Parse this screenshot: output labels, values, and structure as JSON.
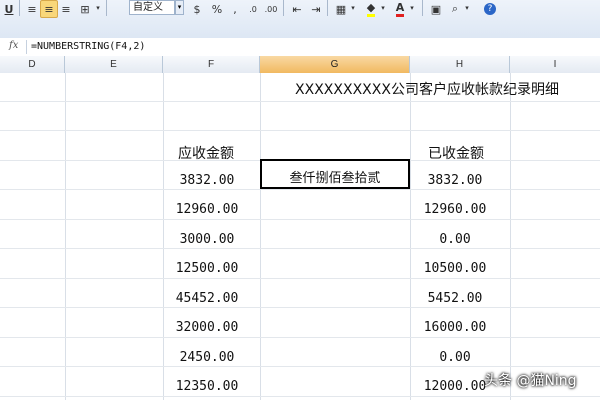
{
  "toolbar": {
    "number_format": "自定义",
    "icons": [
      "underline-icon",
      "align-left-icon",
      "align-center-icon",
      "align-right-icon",
      "merge-center-icon",
      "currency-icon",
      "percent-icon",
      "comma-icon",
      "increase-decimal-icon",
      "decrease-decimal-icon",
      "indent-decrease-icon",
      "indent-increase-icon",
      "borders-icon",
      "fill-color-icon",
      "font-color-icon",
      "picture-icon",
      "zoom-icon",
      "help-icon"
    ],
    "font_color_glyph": "A",
    "percent_glyph": "%"
  },
  "formula_bar": {
    "fx_label": "fx",
    "formula": "=NUMBERSTRING(F4,2)"
  },
  "columns": [
    "D",
    "E",
    "F",
    "G",
    "H",
    "I"
  ],
  "sheet": {
    "title": "XXXXXXXXXX公司客户应收帐款纪录明细",
    "header_receivable": "应收金额",
    "header_received": "已收金额",
    "active_cell_text": "叁仟捌佰叁拾贰",
    "receivable": [
      "3832.00",
      "12960.00",
      "3000.00",
      "12500.00",
      "45452.00",
      "32000.00",
      "2450.00",
      "12350.00"
    ],
    "received": [
      "3832.00",
      "12960.00",
      "0.00",
      "10500.00",
      "5452.00",
      "16000.00",
      "0.00",
      "12000.00"
    ]
  },
  "watermark": "头条 @猫Ning"
}
